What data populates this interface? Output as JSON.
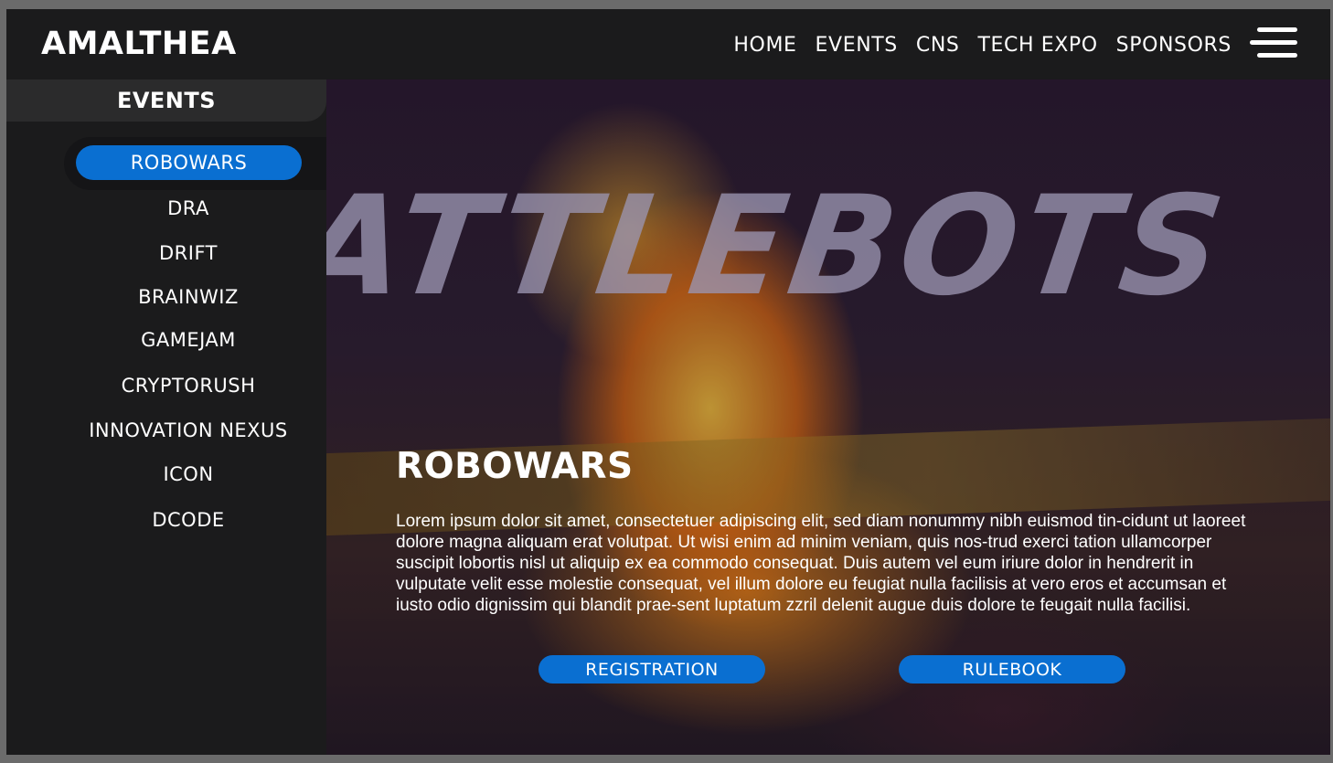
{
  "header": {
    "logo": "AMALTHEA",
    "nav": [
      "HOME",
      "EVENTS",
      "CNS",
      "TECH EXPO",
      "SPONSORS"
    ],
    "menu_icon": "hamburger-menu-icon"
  },
  "sidebar": {
    "title": "EVENTS",
    "active": "ROBOWARS",
    "items": [
      "DRA",
      "DRIFT",
      "BRAINWIZ",
      "GAMEJAM",
      "CRYPTORUSH",
      "INNOVATION NEXUS",
      "ICON",
      "DCODE"
    ]
  },
  "hero": {
    "background_text": "ATTLEBOTS",
    "title": "ROBOWARS",
    "description": "Lorem ipsum dolor sit amet, consectetuer adipiscing elit, sed diam nonummy nibh euismod tin-cidunt ut laoreet dolore magna aliquam erat volutpat. Ut wisi enim ad minim veniam, quis nos-trud exerci tation ullamcorper suscipit lobortis nisl ut aliquip ex ea commodo consequat. Duis autem vel eum iriure dolor in hendrerit in vulputate velit esse molestie consequat, vel illum dolore eu feugiat nulla facilisis at vero eros et accumsan et iusto odio dignissim qui blandit prae-sent luptatum zzril delenit augue duis dolore te feugait nulla facilisi.",
    "registration_label": "REGISTRATION",
    "rulebook_label": "RULEBOOK"
  },
  "colors": {
    "accent": "#0a6fd1",
    "background": "#1b1b1c",
    "sidebar_header": "#2b2b2c"
  }
}
